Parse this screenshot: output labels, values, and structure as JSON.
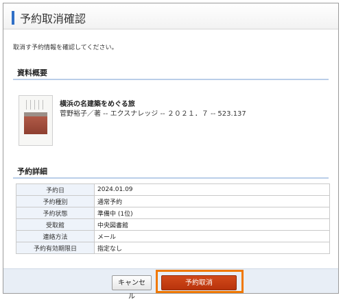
{
  "page": {
    "title": "予約取消確認",
    "instruction": "取消す予約情報を確認してください。"
  },
  "summary": {
    "heading": "資料概要",
    "book_title": "横浜の名建築をめぐる旅",
    "book_meta": "菅野裕子／著 -- エクスナレッジ -- ２０２１．７ -- 523.137"
  },
  "details": {
    "heading": "予約詳細",
    "rows": [
      {
        "label": "予約日",
        "value": "2024.01.09"
      },
      {
        "label": "予約種別",
        "value": "通常予約"
      },
      {
        "label": "予約状態",
        "value": "準備中 (1位)"
      },
      {
        "label": "受取館",
        "value": "中央図書館"
      },
      {
        "label": "連絡方法",
        "value": "メール"
      },
      {
        "label": "予約有効期限日",
        "value": "指定なし"
      }
    ]
  },
  "actions": {
    "cancel_label": "キャンセル",
    "confirm_label": "予約取消"
  },
  "colors": {
    "accent": "#2f6fc6",
    "confirm_button": "#c13d12",
    "highlight_outline": "#f07800"
  }
}
